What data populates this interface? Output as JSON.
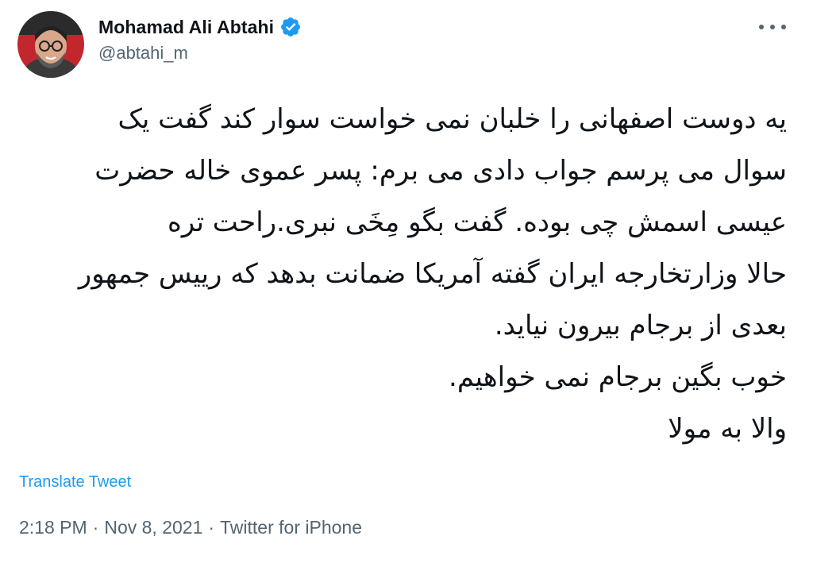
{
  "author": {
    "display_name": "Mohamad Ali Abtahi",
    "handle": "@abtahi_m",
    "verified": true,
    "avatar_icon": "avatar-photo-icon",
    "verified_icon": "verified-badge-icon",
    "verified_color": "#1d9bf0"
  },
  "menu": {
    "icon": "more-options-icon"
  },
  "tweet": {
    "lines": [
      "یه دوست اصفهانی را خلبان نمی خواست سوار کند گفت یک",
      "سوال می پرسم جواب دادی می برم: پسر عموی خاله حضرت",
      "عیسی اسمش چی بوده. گفت بگو مِخَی نبری.راحت تره",
      "حالا وزارتخارجه ایران گفته آمریکا ضمانت بدهد که رییس جمهور",
      "بعدی از برجام بیرون نیاید.",
      "خوب بگین برجام نمی خواهیم.",
      "والا به مولا"
    ],
    "translate_label": "Translate Tweet",
    "time": "2:18 PM",
    "date": "Nov 8, 2021",
    "source": "Twitter for iPhone",
    "separator": "·"
  },
  "colors": {
    "link": "#1d9bf0",
    "secondary_text": "#536471",
    "primary_text": "#0f1419"
  }
}
